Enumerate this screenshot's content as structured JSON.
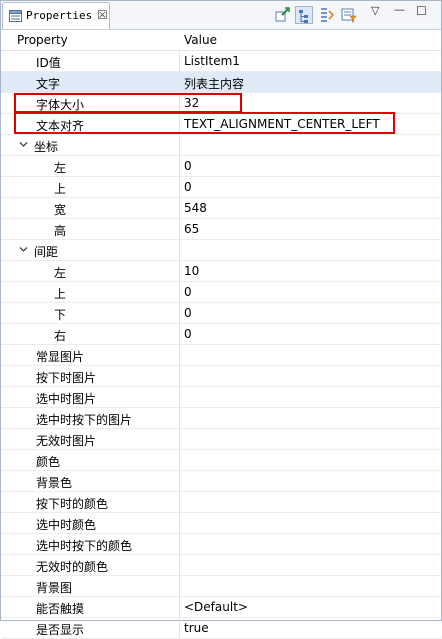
{
  "tab": {
    "title": "Properties",
    "close_glyph": "☒"
  },
  "toolbar": {
    "icons": [
      "pin-edit-icon",
      "tree-view-icon",
      "categories-icon",
      "filter-icon"
    ],
    "menu_glyph": "▽",
    "minimize_glyph": "—",
    "maximize_glyph": "☐"
  },
  "header": {
    "property": "Property",
    "value": "Value"
  },
  "rows": [
    {
      "label": "ID值",
      "value": "ListItem1"
    },
    {
      "label": "文字",
      "value": "列表主内容"
    },
    {
      "label": "字体大小",
      "value": "32"
    },
    {
      "label": "文本对齐",
      "value": "TEXT_ALIGNMENT_CENTER_LEFT"
    },
    {
      "label": "坐标",
      "value": ""
    },
    {
      "label": "左",
      "value": "0"
    },
    {
      "label": "上",
      "value": "0"
    },
    {
      "label": "宽",
      "value": "548"
    },
    {
      "label": "高",
      "value": "65"
    },
    {
      "label": "间距",
      "value": ""
    },
    {
      "label": "左",
      "value": "10"
    },
    {
      "label": "上",
      "value": "0"
    },
    {
      "label": "下",
      "value": "0"
    },
    {
      "label": "右",
      "value": "0"
    },
    {
      "label": "常显图片",
      "value": ""
    },
    {
      "label": "按下时图片",
      "value": ""
    },
    {
      "label": "选中时图片",
      "value": ""
    },
    {
      "label": "选中时按下的图片",
      "value": ""
    },
    {
      "label": "无效时图片",
      "value": ""
    },
    {
      "label": "颜色",
      "value": ""
    },
    {
      "label": "背景色",
      "value": ""
    },
    {
      "label": "按下时的颜色",
      "value": ""
    },
    {
      "label": "选中时颜色",
      "value": ""
    },
    {
      "label": "选中时按下的颜色",
      "value": ""
    },
    {
      "label": "无效时的颜色",
      "value": ""
    },
    {
      "label": "背景图",
      "value": ""
    },
    {
      "label": "能否触摸",
      "value": "<Default>"
    },
    {
      "label": "是否显示",
      "value": "true"
    }
  ],
  "colors": {
    "selection": "#dfeaf7",
    "highlight": "#e00000"
  }
}
